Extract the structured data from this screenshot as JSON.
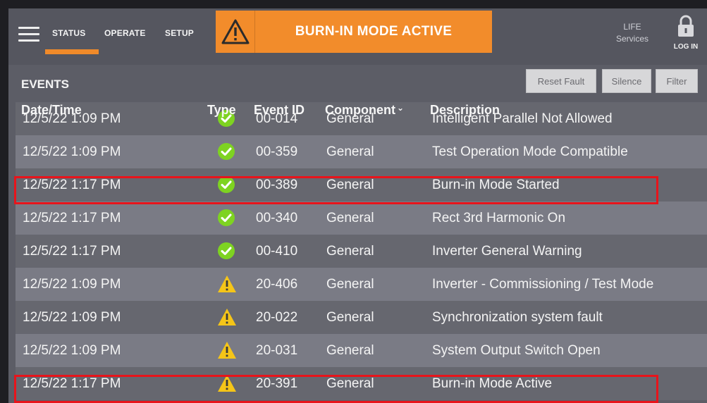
{
  "nav": {
    "tabs": [
      "STATUS",
      "OPERATE",
      "SETUP"
    ]
  },
  "banner": {
    "text": "BURN-IN MODE ACTIVE",
    "icon": "warning-icon",
    "color": "#f28c2b"
  },
  "header_right": {
    "life_line1": "LIFE",
    "life_line2": "Services",
    "login_label": "LOG IN",
    "login_icon": "lock-icon"
  },
  "events": {
    "title": "EVENTS",
    "buttons": {
      "reset_fault": "Reset Fault",
      "silence": "Silence",
      "filter": "Filter"
    },
    "columns": {
      "datetime": "Date/Time",
      "type": "Type",
      "event_id": "Event ID",
      "component": "Component",
      "description": "Description"
    },
    "rows": [
      {
        "datetime": "12/5/22 1:09 PM",
        "type": "check",
        "event_id": "00-014",
        "component": "General",
        "description": "Intelligent Parallel Not Allowed"
      },
      {
        "datetime": "12/5/22 1:09 PM",
        "type": "check",
        "event_id": "00-359",
        "component": "General",
        "description": "Test Operation Mode Compatible"
      },
      {
        "datetime": "12/5/22 1:17 PM",
        "type": "check",
        "event_id": "00-389",
        "component": "General",
        "description": "Burn-in Mode Started"
      },
      {
        "datetime": "12/5/22 1:17 PM",
        "type": "check",
        "event_id": "00-340",
        "component": "General",
        "description": "Rect 3rd Harmonic On"
      },
      {
        "datetime": "12/5/22 1:17 PM",
        "type": "check",
        "event_id": "00-410",
        "component": "General",
        "description": "Inverter General Warning"
      },
      {
        "datetime": "12/5/22 1:09 PM",
        "type": "warning",
        "event_id": "20-406",
        "component": "General",
        "description": "Inverter - Commissioning / Test Mode"
      },
      {
        "datetime": "12/5/22 1:09 PM",
        "type": "warning",
        "event_id": "20-022",
        "component": "General",
        "description": "Synchronization system fault"
      },
      {
        "datetime": "12/5/22 1:09 PM",
        "type": "warning",
        "event_id": "20-031",
        "component": "General",
        "description": "System Output Switch Open"
      },
      {
        "datetime": "12/5/22 1:17 PM",
        "type": "warning",
        "event_id": "20-391",
        "component": "General",
        "description": "Burn-in Mode Active"
      }
    ]
  },
  "colors": {
    "accent": "#f08a2a",
    "highlight": "#e8141b",
    "check": "#7ed321",
    "warning": "#f5c518"
  }
}
